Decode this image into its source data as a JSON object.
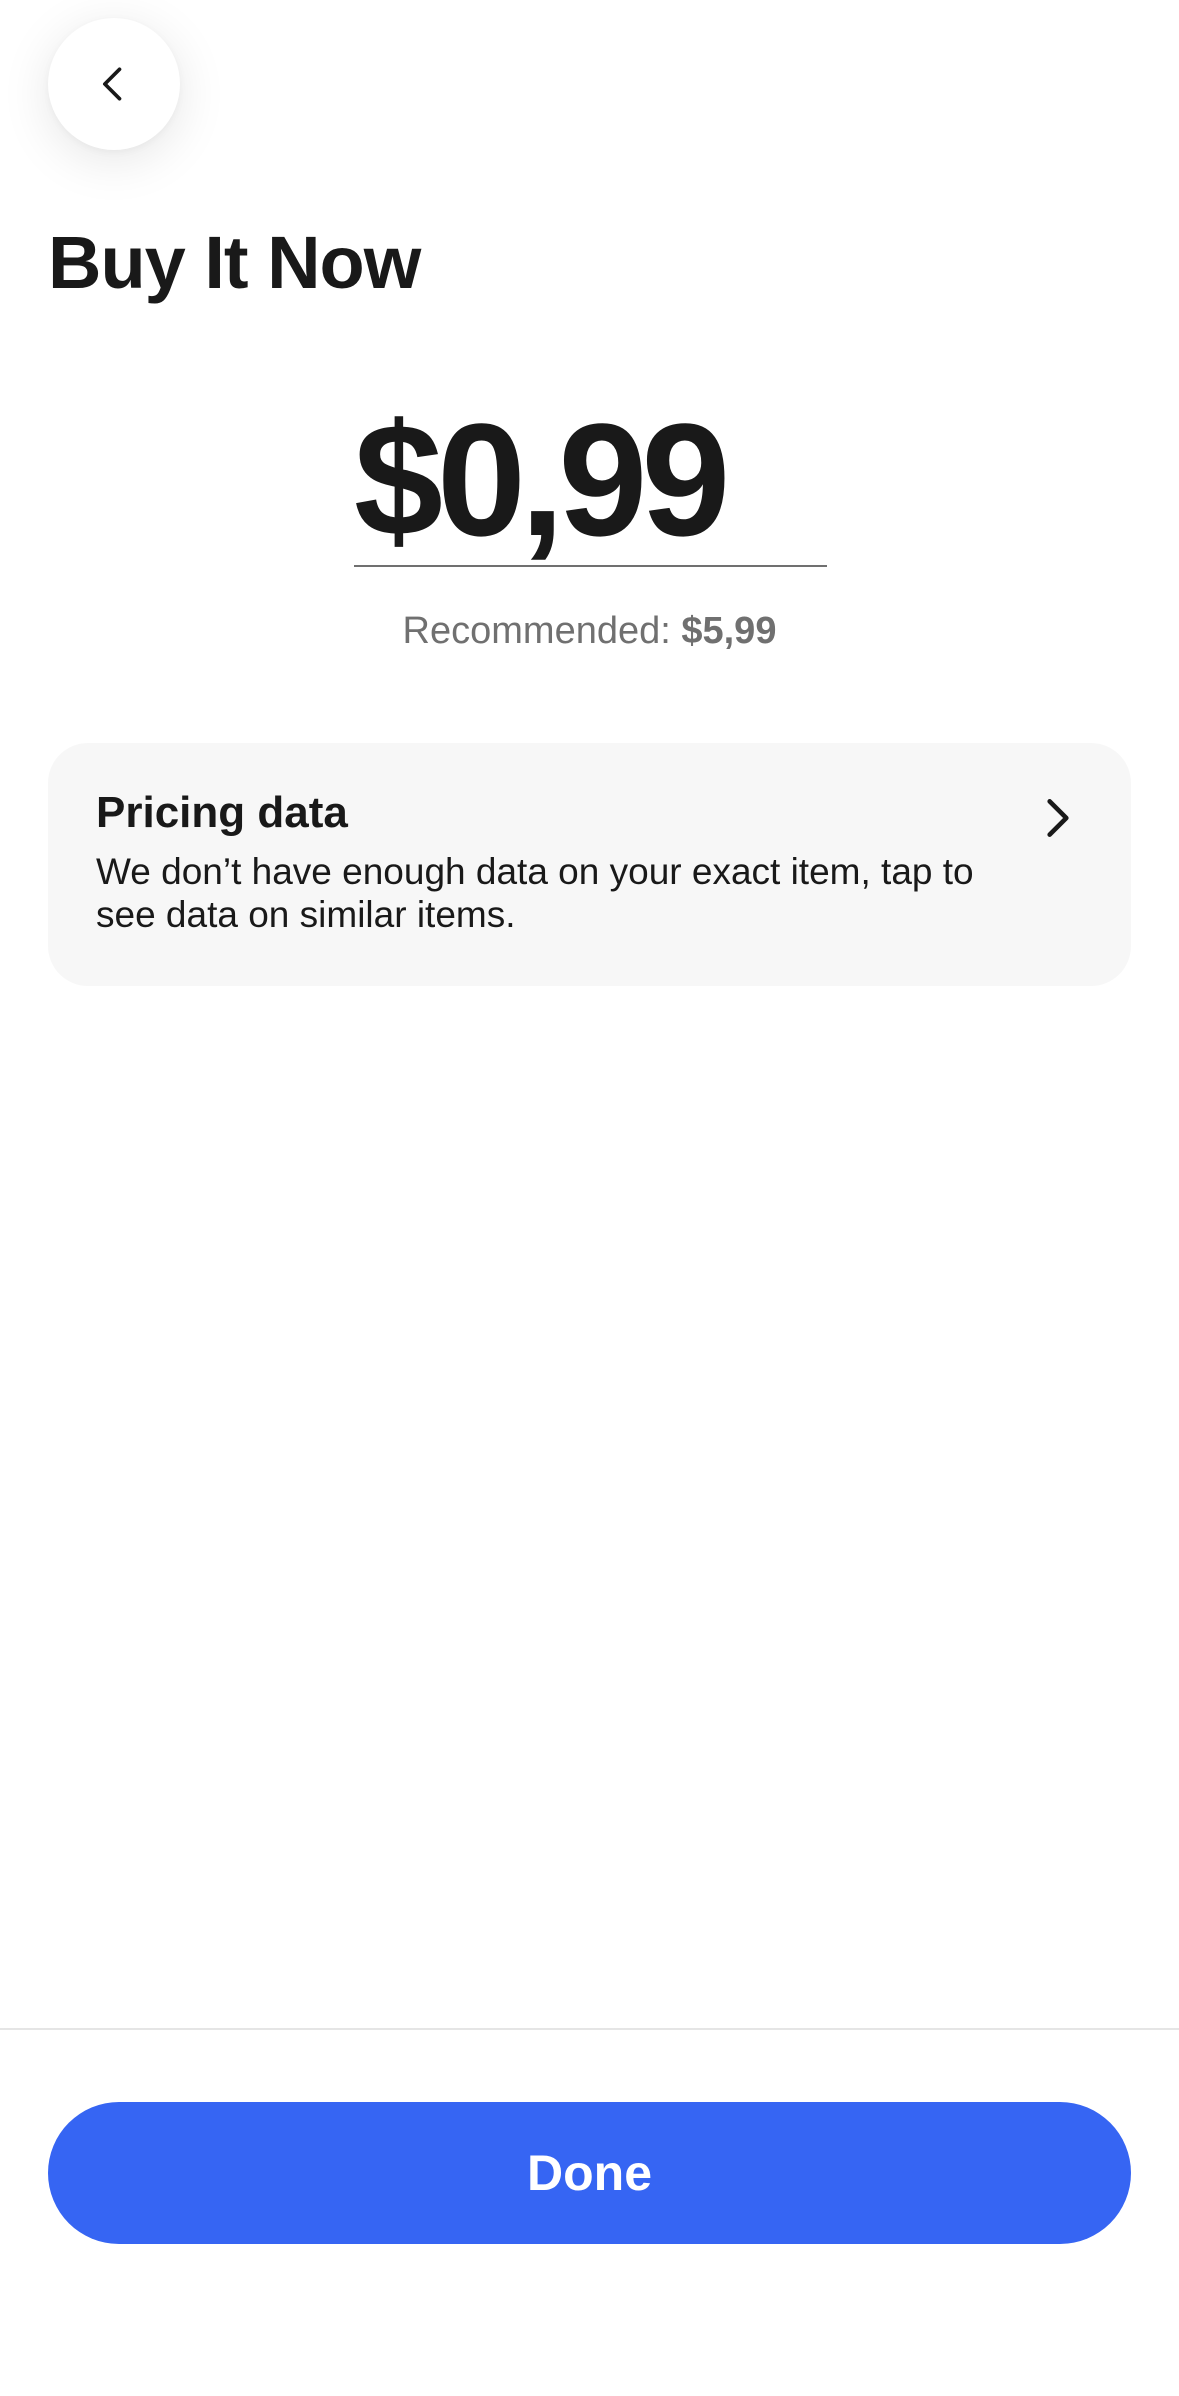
{
  "header": {
    "back_icon": "chevron-left-icon",
    "title": "Buy It Now"
  },
  "price": {
    "value": "$0,99",
    "recommended_label": "Recommended:",
    "recommended_value": "$5,99"
  },
  "pricing_card": {
    "title": "Pricing data",
    "description": "We don’t have enough data on your exact item, tap to see data on similar items.",
    "icon": "chevron-right-icon"
  },
  "footer": {
    "done_label": "Done"
  },
  "colors": {
    "accent": "#3665f3",
    "card_bg": "#f7f7f7",
    "text": "#191919",
    "muted": "#707070"
  }
}
